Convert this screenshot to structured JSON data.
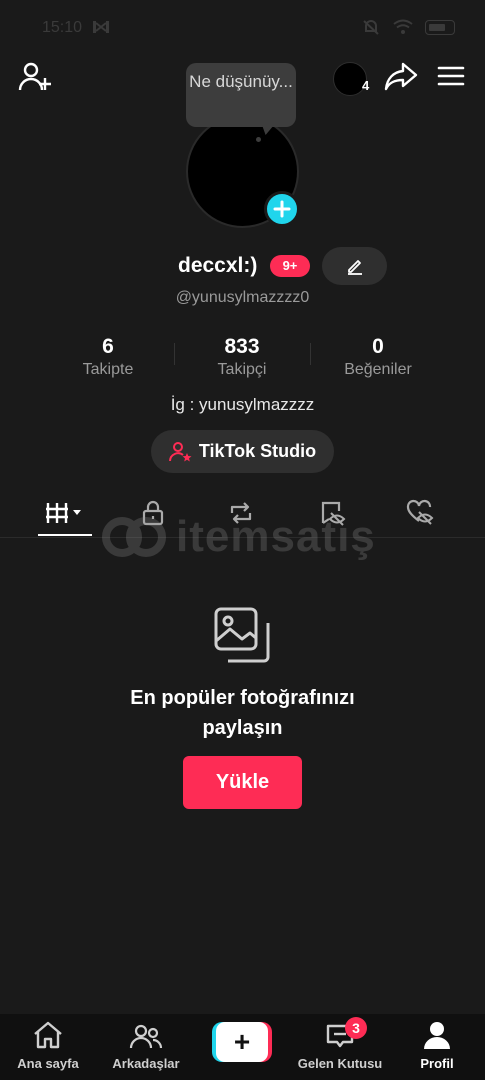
{
  "status_bar": {
    "time": "15:10",
    "battery_level": 0.77
  },
  "header": {
    "mini_avatar_count": "4",
    "note_bubble": "Ne düşünüy..."
  },
  "profile": {
    "display_name": "deccxl:)",
    "badge": "9+",
    "username": "@yunusylmazzzz0",
    "bio": "İg : yunusylmazzzz"
  },
  "stats": [
    {
      "value": "6",
      "label": "Takipte"
    },
    {
      "value": "833",
      "label": "Takipçi"
    },
    {
      "value": "0",
      "label": "Beğeniler"
    }
  ],
  "studio_button": {
    "label": "TikTok Studio"
  },
  "tabs": [
    {
      "icon": "grid-icon",
      "active": true
    },
    {
      "icon": "lock-icon",
      "active": false
    },
    {
      "icon": "repost-icon",
      "active": false
    },
    {
      "icon": "saved-eye-off-icon",
      "active": false
    },
    {
      "icon": "liked-heart-eye-off-icon",
      "active": false
    }
  ],
  "watermark": {
    "text": "itemsatış"
  },
  "empty_state": {
    "title_line1": "En popüler fotoğrafınızı",
    "title_line2": "paylaşın",
    "upload_label": "Yükle"
  },
  "bottom_nav": {
    "home": "Ana sayfa",
    "friends": "Arkadaşlar",
    "create": "+",
    "inbox": "Gelen Kutusu",
    "inbox_badge": "3",
    "profile": "Profil"
  },
  "colors": {
    "background": "#1a1a1a",
    "accent_red": "#fe2c55",
    "accent_cyan": "#20d5ec"
  }
}
